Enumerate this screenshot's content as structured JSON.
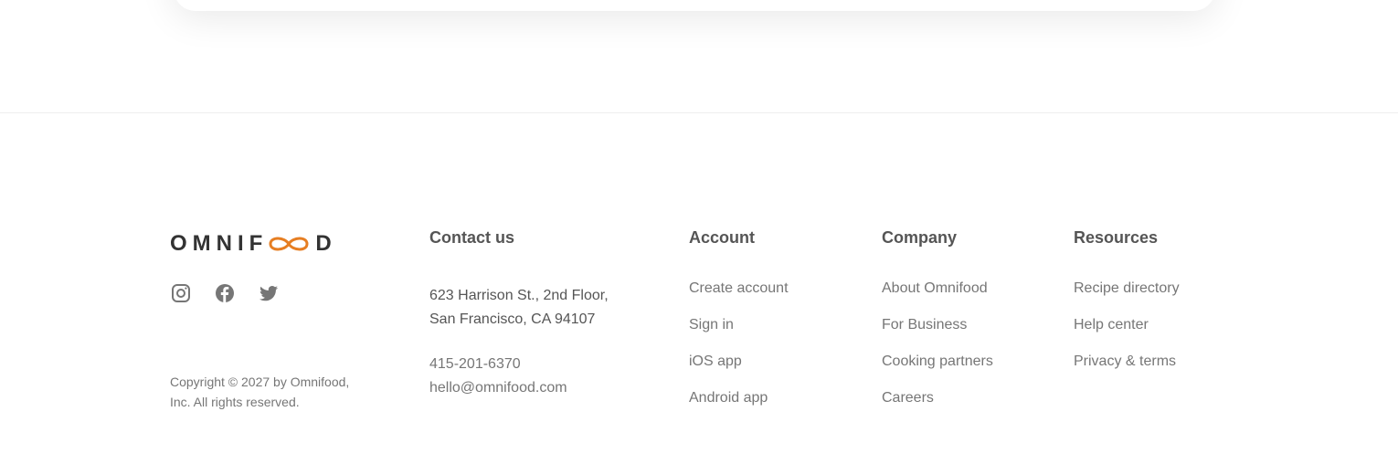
{
  "logo": {
    "text_before": "OMNIF",
    "text_after": "D",
    "symbol_icon": "infinity-icon",
    "brand_color": "#e67e22"
  },
  "social": [
    {
      "name": "instagram",
      "icon": "instagram-icon"
    },
    {
      "name": "facebook",
      "icon": "facebook-icon"
    },
    {
      "name": "twitter",
      "icon": "twitter-icon"
    }
  ],
  "copyright": {
    "line1": "Copyright © 2027 by Omnifood,",
    "line2": "Inc. All rights reserved."
  },
  "contact": {
    "title": "Contact us",
    "address_line1": "623 Harrison St., 2nd Floor,",
    "address_line2": "San Francisco, CA 94107",
    "phone": "415-201-6370",
    "email": "hello@omnifood.com"
  },
  "account": {
    "title": "Account",
    "links": [
      "Create account",
      "Sign in",
      "iOS app",
      "Android app"
    ]
  },
  "company": {
    "title": "Company",
    "links": [
      "About Omnifood",
      "For Business",
      "Cooking partners",
      "Careers"
    ]
  },
  "resources": {
    "title": "Resources",
    "links": [
      "Recipe directory",
      "Help center",
      "Privacy & terms"
    ]
  },
  "colors": {
    "text_dark": "#555555",
    "text_light": "#767676",
    "icon": "#767676",
    "divider": "#eeeeee"
  }
}
